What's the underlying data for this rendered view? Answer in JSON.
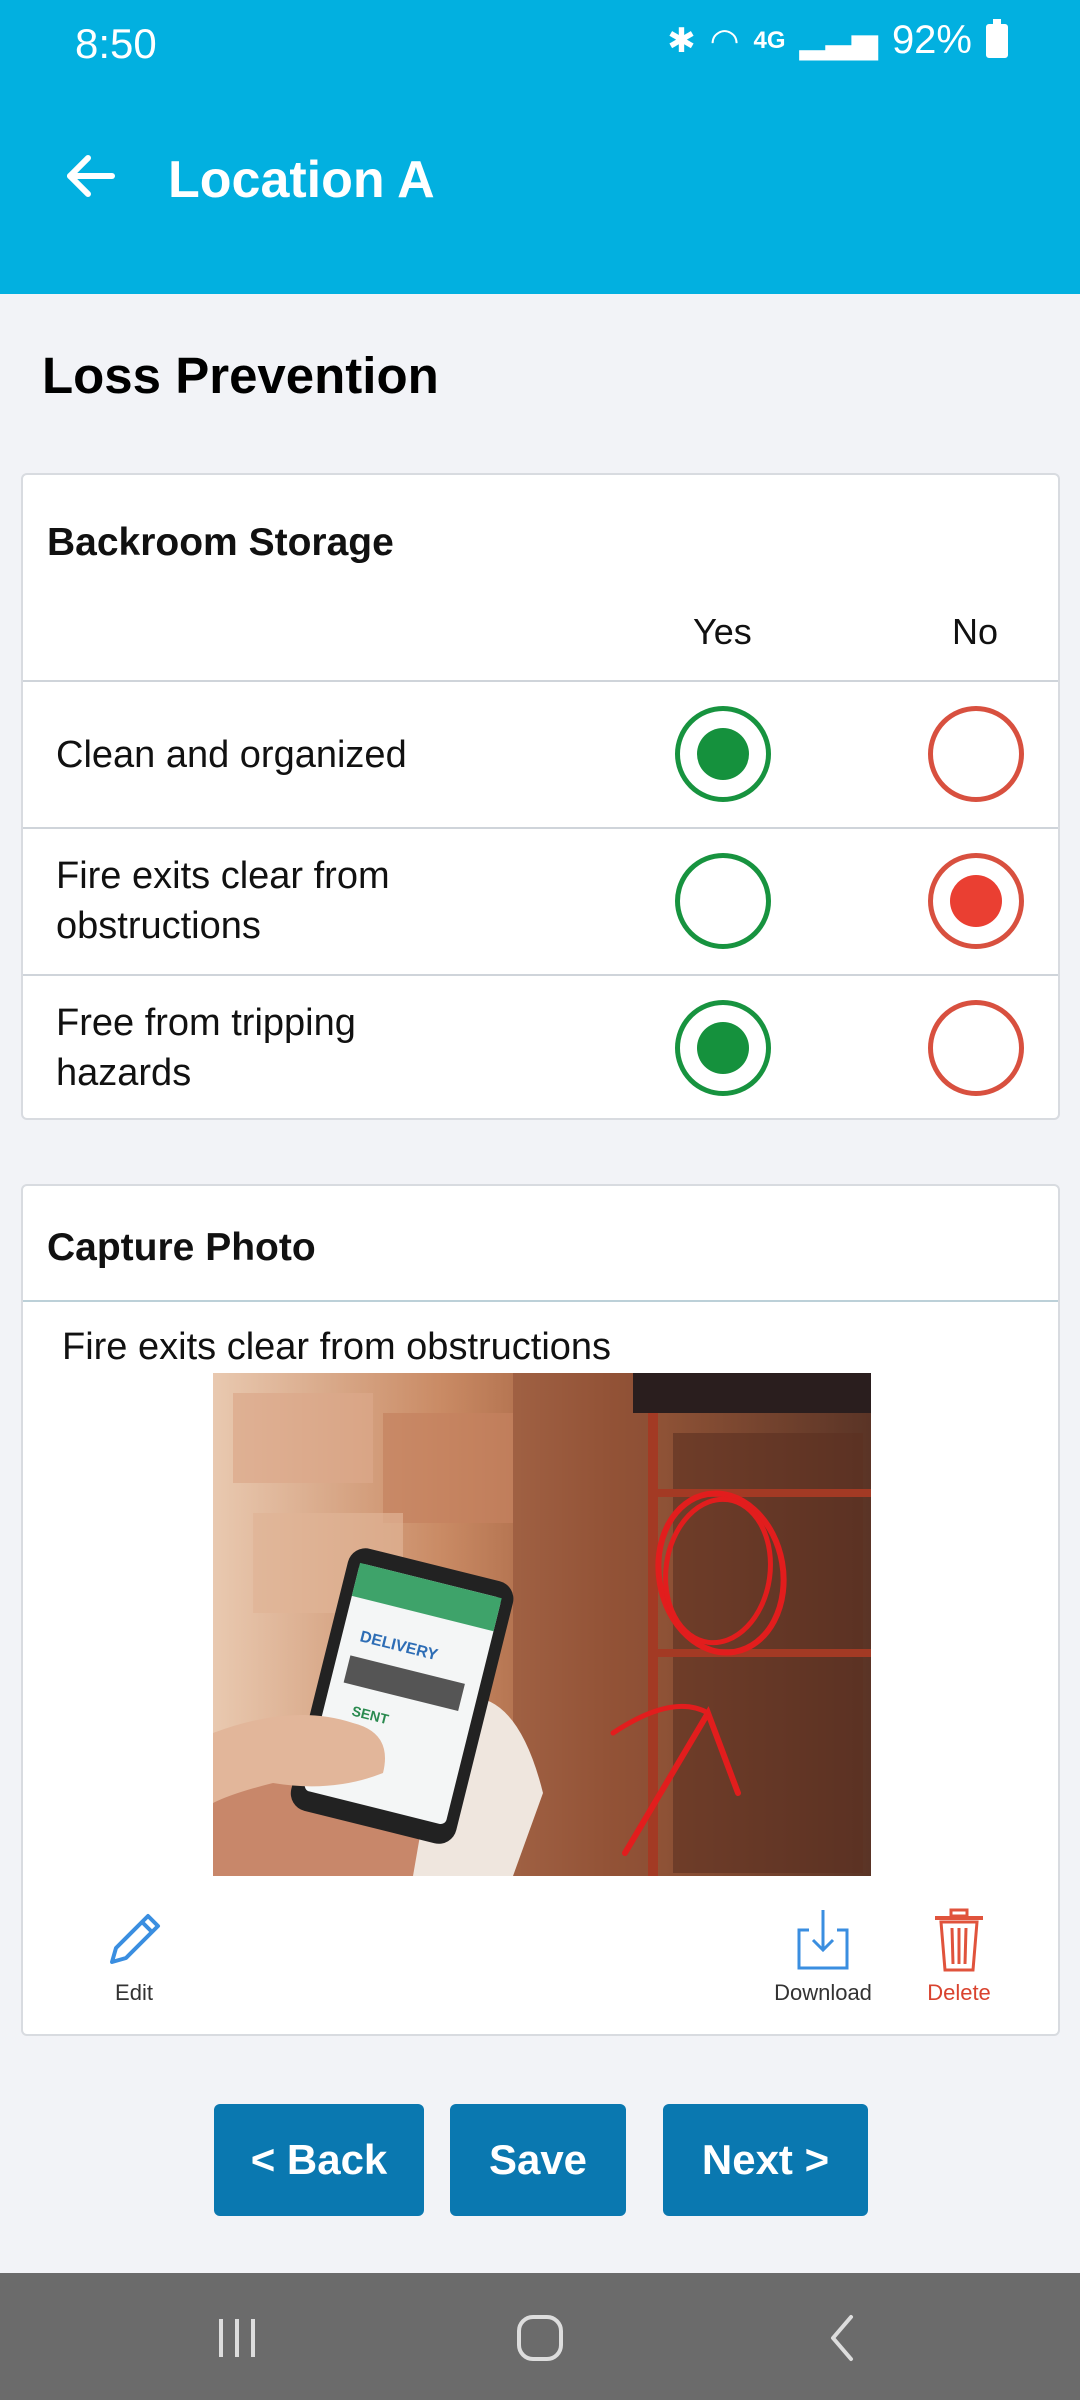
{
  "status_bar": {
    "time": "8:50",
    "network": "4G",
    "battery": "92%"
  },
  "app_bar": {
    "title": "Location A"
  },
  "page": {
    "title": "Loss Prevention"
  },
  "storage_section": {
    "heading": "Backroom Storage",
    "columns": {
      "yes": "Yes",
      "no": "No"
    },
    "items": [
      {
        "label_line1": "Clean and organized",
        "label_line2": "",
        "answer": "Yes"
      },
      {
        "label_line1": "Fire exits clear from",
        "label_line2": "obstructions",
        "answer": "No"
      },
      {
        "label_line1": "Free from tripping",
        "label_line2": "hazards",
        "answer": "Yes"
      }
    ]
  },
  "photo_section": {
    "heading": "Capture Photo",
    "caption": "Fire exits clear from obstructions",
    "phone_screen_text": [
      "DELIVERY",
      "SENT"
    ],
    "actions": {
      "edit": "Edit",
      "download": "Download",
      "delete": "Delete"
    }
  },
  "buttons": {
    "back": "< Back",
    "save": "Save",
    "next": "Next >"
  },
  "colors": {
    "header": "#02b0e0",
    "button": "#0a78b0",
    "yes": "#15913d",
    "no": "#ea3f32",
    "delete": "#d9432f"
  }
}
